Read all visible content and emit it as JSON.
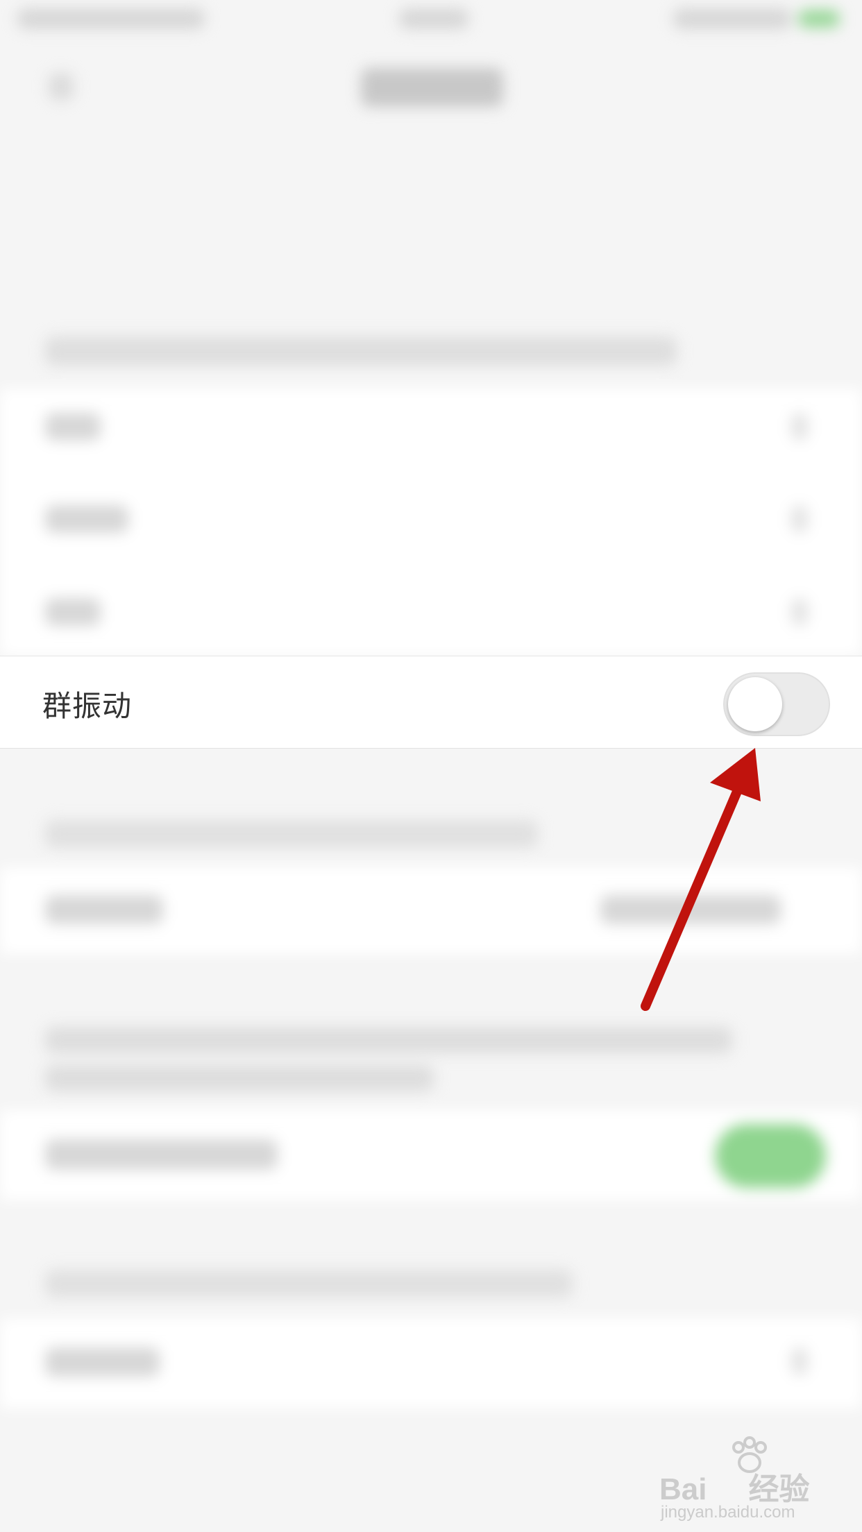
{
  "settings": {
    "vibration_row": {
      "label": "群振动",
      "toggle_on": false
    }
  },
  "watermark": {
    "brand_text_a": "Bai",
    "brand_text_b": "经验",
    "url": "jingyan.baidu.com"
  },
  "colors": {
    "background": "#f5f5f5",
    "panel": "#ffffff",
    "toggle_off": "#ebebeb",
    "toggle_on_accent": "#4cd964",
    "arrow": "#c0130d"
  },
  "icons": {
    "annotation_arrow": "arrow-icon",
    "back": "back-icon",
    "watermark_paw": "paw-icon"
  }
}
